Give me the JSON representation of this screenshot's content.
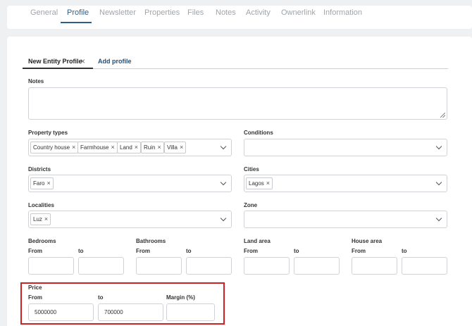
{
  "tabs": [
    "General",
    "Profile",
    "Newsletter",
    "Properties",
    "Files",
    "Notes",
    "Activity",
    "Ownerlink",
    "Information"
  ],
  "active_tab": "Profile",
  "profile_tabs": {
    "active": "New Entity Profile",
    "add": "Add profile"
  },
  "notes": {
    "label": "Notes",
    "value": ""
  },
  "property_types": {
    "label": "Property types",
    "chips": [
      "Country house",
      "Farmhouse",
      "Land",
      "Ruin",
      "Villa"
    ]
  },
  "conditions": {
    "label": "Conditions",
    "chips": []
  },
  "districts": {
    "label": "Districts",
    "chips": [
      "Faro"
    ]
  },
  "cities": {
    "label": "Cities",
    "chips": [
      "Lagos"
    ]
  },
  "localities": {
    "label": "Localities",
    "chips": [
      "Luz"
    ]
  },
  "zone": {
    "label": "Zone",
    "chips": []
  },
  "from_label": "From",
  "to_label": "to",
  "bedrooms": {
    "label": "Bedrooms",
    "from": "",
    "to": ""
  },
  "bathrooms": {
    "label": "Bathrooms",
    "from": "",
    "to": ""
  },
  "land_area": {
    "label": "Land area",
    "from": "",
    "to": ""
  },
  "house_area": {
    "label": "House area",
    "from": "",
    "to": ""
  },
  "price": {
    "label": "Price",
    "from": "5000000",
    "to": "700000",
    "margin_label": "Margin (%)",
    "margin": ""
  },
  "colors": {
    "accent": "#2b5f8a",
    "highlight": "#d21f24"
  }
}
